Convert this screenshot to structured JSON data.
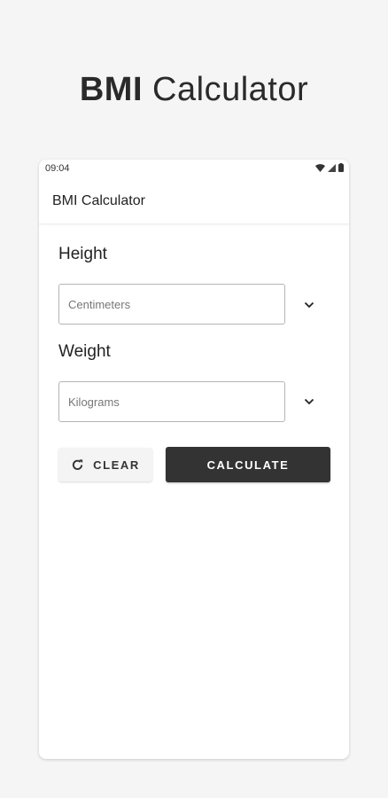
{
  "promo": {
    "title_bold": "BMI",
    "title_rest": " Calculator"
  },
  "status_bar": {
    "time": "09:04",
    "icons": [
      "wifi-icon",
      "signal-icon",
      "battery-icon"
    ]
  },
  "app_bar": {
    "title": "BMI Calculator"
  },
  "height": {
    "label": "Height",
    "unit_placeholder": "Centimeters",
    "dropdown_icon": "chevron-down-icon"
  },
  "weight": {
    "label": "Weight",
    "unit_placeholder": "Kilograms",
    "dropdown_icon": "chevron-down-icon"
  },
  "actions": {
    "clear_label": "CLEAR",
    "clear_icon": "refresh-icon",
    "calculate_label": "CALCULATE"
  },
  "colors": {
    "background": "#f5f5f5",
    "surface": "#ffffff",
    "primary_button": "#333333",
    "text": "#222222"
  }
}
